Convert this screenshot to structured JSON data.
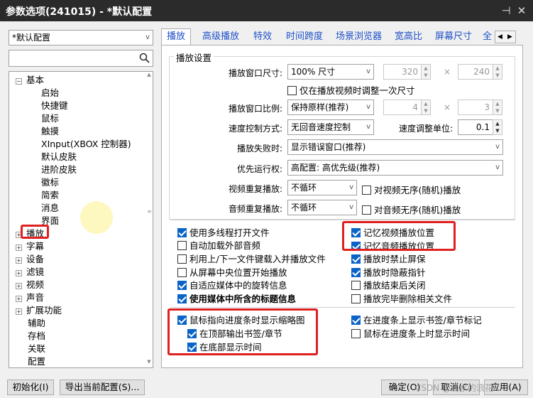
{
  "window": {
    "title": "参数选项(241015) - *默认配置",
    "pin_icon": "pin-icon",
    "close_icon": "close-icon"
  },
  "profile": {
    "selected": "*默认配置"
  },
  "search": {
    "value": "",
    "placeholder": ""
  },
  "tree": {
    "basic": "基本",
    "basic_children": [
      "启始",
      "快捷键",
      "鼠标",
      "触摸",
      "XInput(XBOX 控制器)",
      "默认皮肤",
      "进阶皮肤",
      "徽标",
      "简索",
      "消息",
      "界面"
    ],
    "top": [
      "播放",
      "字幕",
      "设备",
      "滤镜",
      "视频",
      "声音",
      "扩展功能"
    ],
    "leaf": [
      "辅助",
      "存档",
      "关联",
      "配置"
    ]
  },
  "tabs": [
    "播放",
    "高级播放",
    "特效",
    "时间跨度",
    "场景浏览器",
    "宽高比",
    "屏幕尺寸",
    "全"
  ],
  "group_title": "播放设置",
  "form": {
    "window_size_label": "播放窗口尺寸:",
    "window_size_value": "100% 尺寸",
    "w1": "320",
    "h1": "240",
    "times": "×",
    "only_adjust_once": "仅在播放视频时调整一次尺寸",
    "ratio_label": "播放窗口比例:",
    "ratio_value": "保持原样(推荐)",
    "w2": "4",
    "h2": "3",
    "speed_label": "速度控制方式:",
    "speed_value": "无回音速度控制",
    "speed_unit_label": "速度调整单位:",
    "speed_unit_value": "0.1",
    "fail_label": "播放失败时:",
    "fail_value": "显示错误窗口(推荐)",
    "priority_label": "优先运行权:",
    "priority_value": "高配置: 高优先级(推荐)",
    "video_repeat_label": "视频重复播放:",
    "video_repeat_value": "不循环",
    "video_shuffle": "对视频无序(随机)播放",
    "audio_repeat_label": "音频重复播放:",
    "audio_repeat_value": "不循环",
    "audio_shuffle": "对音频无序(随机)播放"
  },
  "opts_left": [
    {
      "label": "使用多线程打开文件",
      "checked": true
    },
    {
      "label": "自动加载外部音频",
      "checked": false
    },
    {
      "label": "利用上/下一文件键载入并播放文件",
      "checked": false
    },
    {
      "label": "从屏幕中央位置开始播放",
      "checked": false
    },
    {
      "label": "自适应媒体中的旋转信息",
      "checked": true
    },
    {
      "label": "使用媒体中所含的标题信息",
      "checked": true
    }
  ],
  "opts_right": [
    {
      "label": "记忆视频播放位置",
      "checked": true
    },
    {
      "label": "记忆音频播放位置",
      "checked": true
    },
    {
      "label": "播放时禁止屏保",
      "checked": true
    },
    {
      "label": "播放时隐蔽指针",
      "checked": true
    },
    {
      "label": "播放结束后关闭",
      "checked": false
    },
    {
      "label": "播放完毕删除相关文件",
      "checked": false
    }
  ],
  "thumb": {
    "main": "鼠标指向进度条时显示缩略图",
    "top": "在顶部输出书签/章节",
    "bottom": "在底部显示时间",
    "show_bookmarks": "在进度条上显示书签/章节标记",
    "show_time": "鼠标在进度条上时显示时间"
  },
  "buttons": {
    "init": "初始化(I)",
    "export": "导出当前配置(S)...",
    "ok": "确定(O)",
    "cancel": "取消(C)",
    "apply": "应用(A)"
  },
  "watermark": "CSDN @浅水的浪花"
}
